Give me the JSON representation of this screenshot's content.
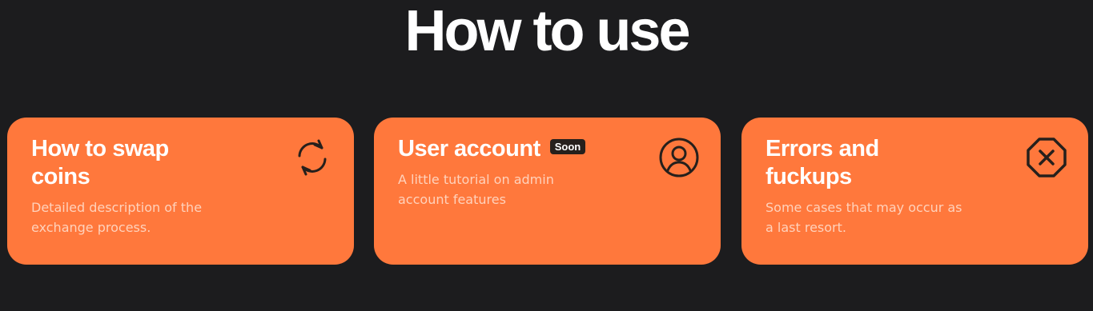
{
  "section": {
    "title": "How to use"
  },
  "cards": [
    {
      "title": "How to swap coins",
      "description": "Detailed description of the exchange process.",
      "icon": "refresh-icon"
    },
    {
      "title": "User account",
      "badge": "Soon",
      "description": "A little tutorial on admin account features",
      "icon": "user-circle-icon"
    },
    {
      "title": "Errors and fuckups",
      "description": "Some cases that may occur as a last resort.",
      "icon": "octagon-x-icon"
    }
  ],
  "colors": {
    "background": "#1c1c1e",
    "card": "#ff783c",
    "title": "#ffffff",
    "description": "#ffd2bc",
    "icon": "#26201c",
    "badge_bg": "#26201c"
  }
}
